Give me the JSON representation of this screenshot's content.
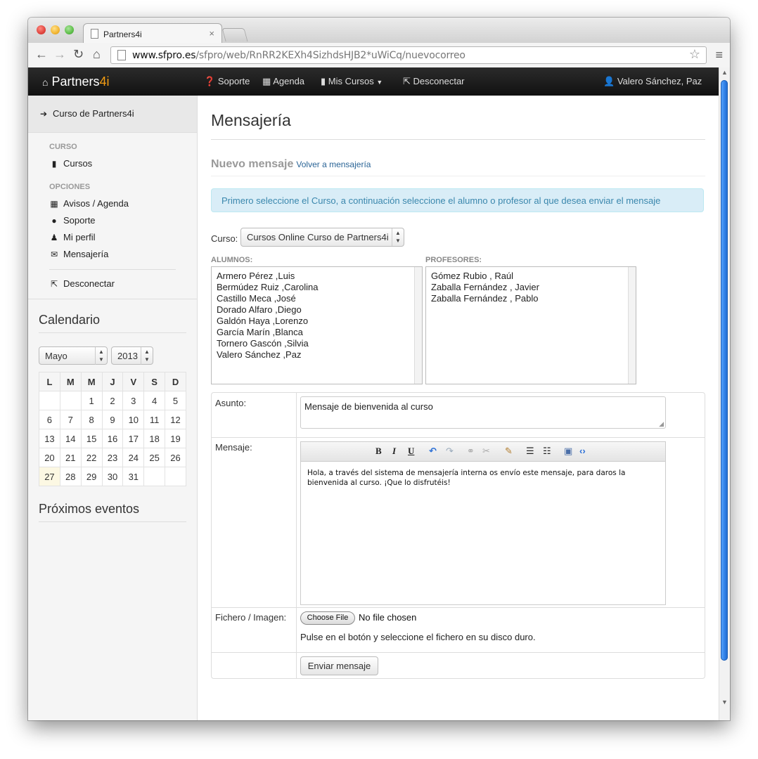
{
  "browser": {
    "tab_title": "Partners4i",
    "tab_close": "×",
    "url_host": "www.sfpro.es",
    "url_path": "/sfpro/web/RnRR2KEXh4SizhdsHJB2*uWiCq/nuevocorreo"
  },
  "navbar": {
    "brand_a": "Partners",
    "brand_b": "4i",
    "items": [
      "Soporte",
      "Agenda",
      "Mis Cursos",
      "Desconectar"
    ],
    "user": "Valero Sánchez, Paz"
  },
  "sidebar": {
    "course_link": "Curso de Partners4i",
    "section_curso": "CURSO",
    "cursos": "Cursos",
    "section_opciones": "OPCIONES",
    "avisos": "Avisos / Agenda",
    "soporte": "Soporte",
    "perfil": "Mi perfil",
    "mensajeria": "Mensajería",
    "desconectar": "Desconectar",
    "calendario_title": "Calendario",
    "month": "Mayo",
    "year": "2013",
    "weekdays": [
      "L",
      "M",
      "M",
      "J",
      "V",
      "S",
      "D"
    ],
    "weeks": [
      [
        "",
        "",
        "1",
        "2",
        "3",
        "4",
        "5"
      ],
      [
        "6",
        "7",
        "8",
        "9",
        "10",
        "11",
        "12"
      ],
      [
        "13",
        "14",
        "15",
        "16",
        "17",
        "18",
        "19"
      ],
      [
        "20",
        "21",
        "22",
        "23",
        "24",
        "25",
        "26"
      ],
      [
        "27",
        "28",
        "29",
        "30",
        "31",
        "",
        ""
      ]
    ],
    "today": "27",
    "eventos_title": "Próximos eventos"
  },
  "main": {
    "title": "Mensajería",
    "subtitle": "Nuevo mensaje",
    "back_link": "Volver a mensajería",
    "alert": "Primero seleccione el Curso, a continuación seleccione el alumno o profesor al que desea enviar el mensaje",
    "curso_label": "Curso:",
    "curso_value": "Cursos Online Curso de Partners4i",
    "alumnos_label": "ALUMNOS:",
    "alumnos": [
      "Armero Pérez ,Luis",
      "Bermúdez Ruiz ,Carolina",
      "Castillo Meca ,José",
      "Dorado Alfaro ,Diego",
      "Galdón Haya ,Lorenzo",
      "García Marín ,Blanca",
      "Tornero Gascón ,Silvia",
      "Valero Sánchez ,Paz"
    ],
    "profesores_label": "PROFESORES:",
    "profesores": [
      "Gómez Rubio , Raúl",
      "Zaballa Fernández , Javier",
      "Zaballa Fernández , Pablo"
    ],
    "asunto_label": "Asunto:",
    "asunto_value": "Mensaje de bienvenida al curso",
    "mensaje_label": "Mensaje:",
    "mensaje_body": "Hola, a través del sistema de mensajería interna os envío este mensaje, para daros la bienvenida al curso. ¡Que lo disfrutéis!",
    "fichero_label": "Fichero / Imagen:",
    "choose_file": "Choose File",
    "no_file": "No file chosen",
    "file_hint": "Pulse en el botón y seleccione el fichero en su disco duro.",
    "send_button": "Enviar mensaje"
  },
  "colors": {
    "accent": "#f39c12",
    "alert_bg": "#d9edf7",
    "alert_text": "#3a87ad",
    "link": "#2a6496"
  }
}
